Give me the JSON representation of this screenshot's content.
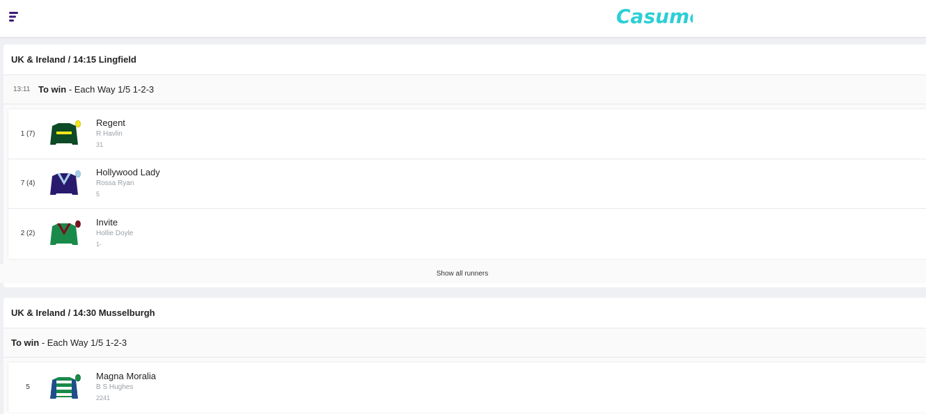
{
  "header": {
    "logo_text": "Casumo",
    "brand_color": "#2ccfd5",
    "menu_icon": "hamburger-menu-icon"
  },
  "events": [
    {
      "title": "UK & Ireland / 14:15 Lingfield",
      "market_time": "13:11",
      "market_name": "To win",
      "market_terms": " - Each Way 1/5 1-2-3",
      "runners": [
        {
          "number": "1 (7)",
          "name": "Regent",
          "jockey": "R Havlin",
          "form": "31",
          "silk": "green-yellow-band"
        },
        {
          "number": "7 (4)",
          "name": "Hollywood Lady",
          "jockey": "Rossa Ryan",
          "form": "5",
          "silk": "purple-lightblue-chevron"
        },
        {
          "number": "2 (2)",
          "name": "Invite",
          "jockey": "Hollie Doyle",
          "form": "1-",
          "silk": "green-maroon-chevron"
        }
      ],
      "show_all_label": "Show all runners"
    },
    {
      "title": "UK & Ireland / 14:30 Musselburgh",
      "market_name": "To win",
      "market_terms": " - Each Way 1/5 1-2-3",
      "runners": [
        {
          "number": "5",
          "name": "Magna Moralia",
          "jockey": "B S Hughes",
          "form": "2241",
          "silk": "green-white-hoops"
        }
      ]
    }
  ]
}
